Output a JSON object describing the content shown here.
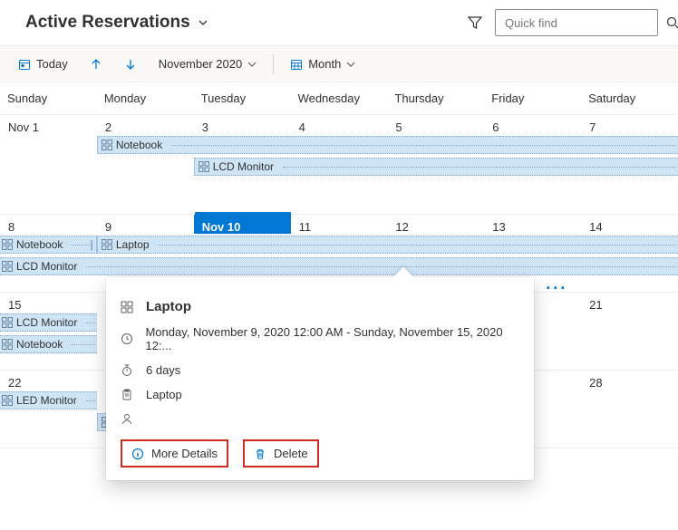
{
  "header": {
    "title": "Active Reservations",
    "search_placeholder": "Quick find"
  },
  "toolbar": {
    "today": "Today",
    "month_label": "November 2020",
    "view": "Month"
  },
  "days": [
    "Sunday",
    "Monday",
    "Tuesday",
    "Wednesday",
    "Thursday",
    "Friday",
    "Saturday"
  ],
  "weeks": [
    {
      "dates": [
        "Nov 1",
        "2",
        "3",
        "4",
        "5",
        "6",
        "7"
      ],
      "today_index": null,
      "events": [
        {
          "row": 0,
          "start": 1,
          "span": 6,
          "label": "Notebook",
          "cont_right": true
        },
        {
          "row": 1,
          "start": 2,
          "span": 5,
          "label": "LCD Monitor",
          "cont_right": true
        }
      ]
    },
    {
      "dates": [
        "8",
        "9",
        "Nov 10",
        "11",
        "12",
        "13",
        "14"
      ],
      "today_index": 2,
      "events": [
        {
          "row": 0,
          "start": 0,
          "span": 1,
          "label": "Notebook",
          "pipe": true,
          "cont_left": true
        },
        {
          "row": 0,
          "start": 1,
          "span": 6,
          "label": "Laptop",
          "cont_right": true
        },
        {
          "row": 1,
          "start": 0,
          "span": 7,
          "label": "LCD Monitor",
          "cont_left": true,
          "cont_right": true
        }
      ],
      "more": [
        {
          "col": 5
        }
      ]
    },
    {
      "dates": [
        "15",
        "",
        "",
        "",
        "",
        "",
        "21"
      ],
      "today_index": null,
      "events": [
        {
          "row": 0,
          "start": 0,
          "span": 1,
          "label": "LCD Monitor",
          "cont_left": true,
          "cont_right": true
        },
        {
          "row": 1,
          "start": 0,
          "span": 1,
          "label": "Notebook",
          "cont_left": true,
          "cont_right": true
        }
      ]
    },
    {
      "dates": [
        "22",
        "",
        "",
        "",
        "",
        "",
        "28"
      ],
      "today_index": null,
      "events": [
        {
          "row": 0,
          "start": 0,
          "span": 1,
          "label": "LED Monitor",
          "cont_left": true,
          "cont_right": true
        },
        {
          "row": 1,
          "start": 1,
          "span": 2,
          "label": "Laptop"
        }
      ]
    }
  ],
  "popover": {
    "title": "Laptop",
    "time_range": "Monday, November 9, 2020 12:00 AM - Sunday, November 15, 2020 12:...",
    "duration": "6 days",
    "resource": "Laptop",
    "more_details": "More Details",
    "delete": "Delete"
  }
}
